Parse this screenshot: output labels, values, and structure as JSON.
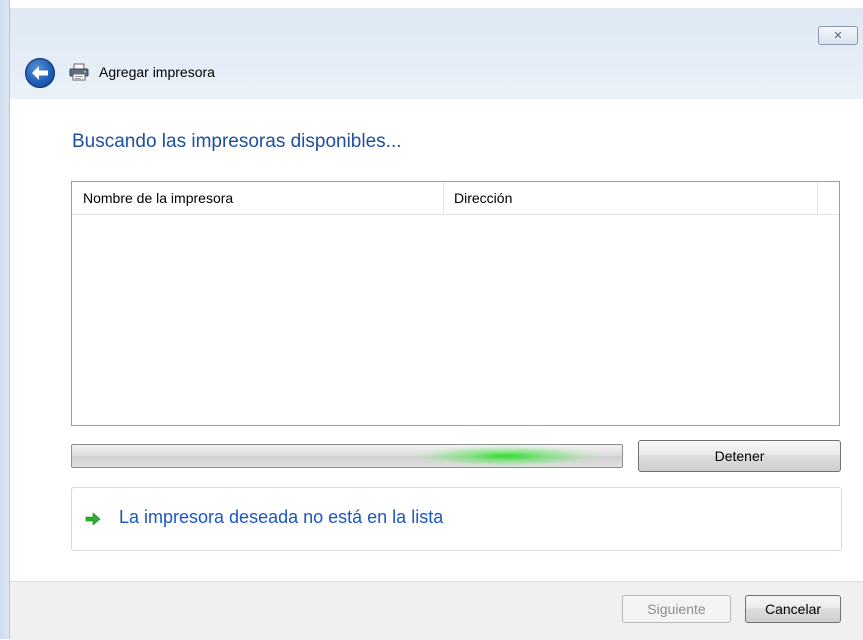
{
  "window": {
    "title": "Agregar impresora",
    "close_glyph": "✕"
  },
  "icons": {
    "back": "back-arrow-icon",
    "printer": "printer-icon",
    "link_arrow": "green-arrow-icon"
  },
  "main": {
    "heading": "Buscando las impresoras disponibles...",
    "columns": [
      "Nombre de la impresora",
      "Dirección"
    ],
    "rows": [],
    "progress_state": "searching",
    "stop_label": "Detener",
    "missing_printer_link": "La impresora deseada no está en la lista"
  },
  "footer": {
    "next_label": "Siguiente",
    "next_enabled": false,
    "cancel_label": "Cancelar"
  },
  "colors": {
    "heading": "#1f4fa0",
    "link": "#1a56c6",
    "progress_glow": "#28dc28",
    "link_arrow": "#2eae2e"
  }
}
